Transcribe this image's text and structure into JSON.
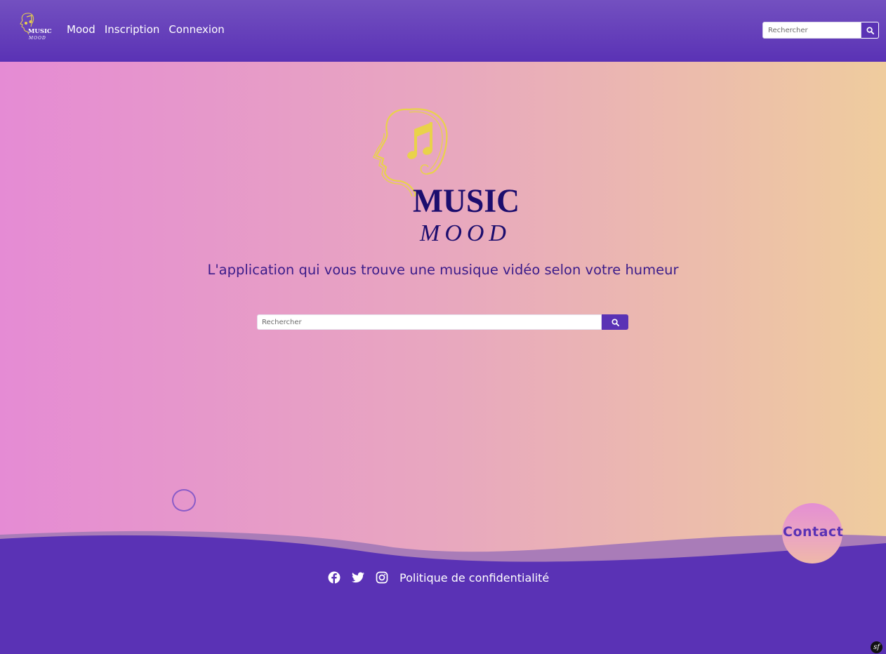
{
  "brand": {
    "logo_word_1": "MUSIC",
    "logo_word_2": "MOOD",
    "primary_color": "#5a32b5",
    "logo_head_color": "#e9d24a",
    "logo_text_color": "#1c0d6e"
  },
  "nav": {
    "items": [
      {
        "label": "Mood"
      },
      {
        "label": "Inscription"
      },
      {
        "label": "Connexion"
      }
    ],
    "search": {
      "placeholder": "Rechercher",
      "button_icon": "search-icon"
    }
  },
  "hero": {
    "tagline": "L'application qui vous trouve une musique vidéo selon votre humeur",
    "search": {
      "placeholder": "Rechercher",
      "button_icon": "search-icon"
    }
  },
  "footer": {
    "contact_label": "Contact",
    "social_icons": [
      "facebook-icon",
      "twitter-icon",
      "instagram-icon"
    ],
    "privacy_label": "Politique de confidentialité",
    "debug_badge": "sf"
  }
}
